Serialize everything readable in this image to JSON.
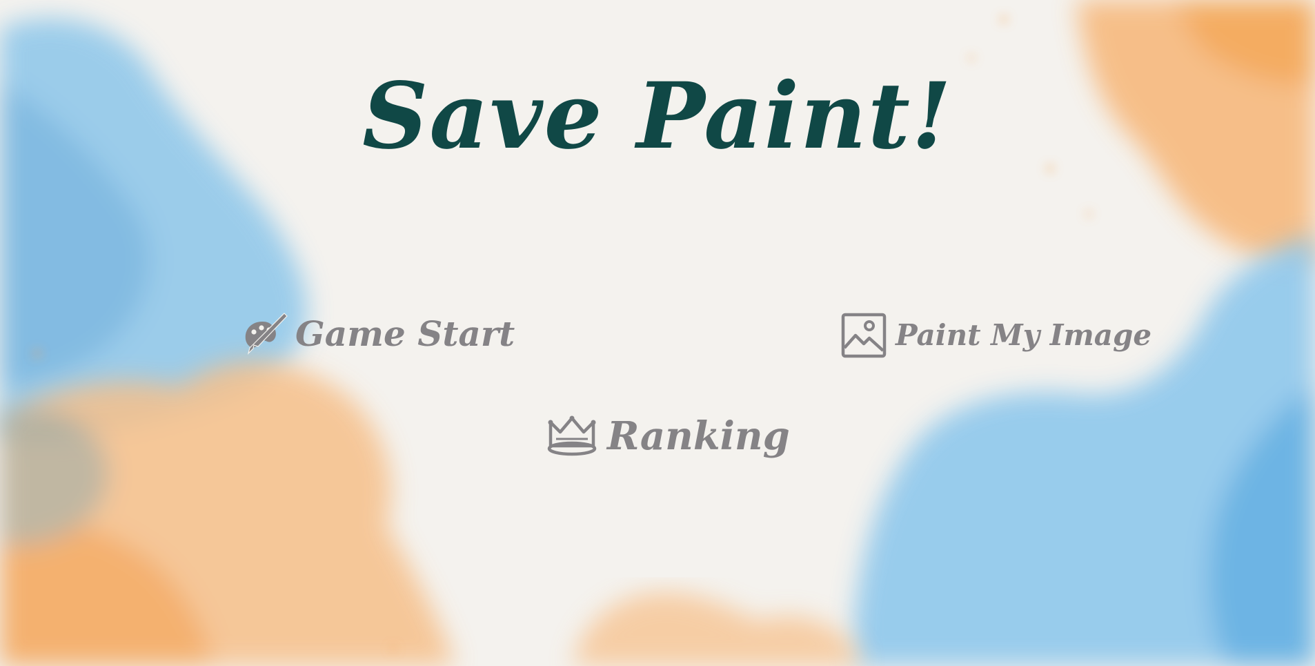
{
  "title": "Save Paint!",
  "menu": {
    "game_start": {
      "label": "Game Start",
      "icon": "palette-brush-icon"
    },
    "paint_my_image": {
      "label": "Paint My Image",
      "icon": "image-icon"
    },
    "ranking": {
      "label": "Ranking",
      "icon": "crown-icon"
    }
  },
  "colors": {
    "title": "#104846",
    "menu_text": "#858386",
    "watercolor_blue": "#6fb8e6",
    "watercolor_orange": "#f7a85a",
    "paper": "#f4f2ee"
  }
}
